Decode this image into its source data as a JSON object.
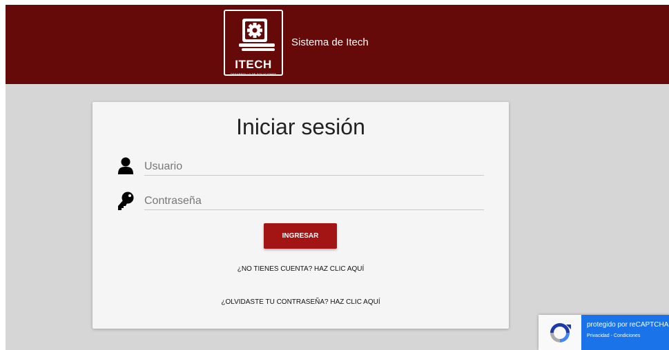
{
  "header": {
    "logo_text": "ITECH",
    "logo_subtext": "DESARROLLO DE SOLUCIONES",
    "site_title": "Sistema de Itech",
    "bg_color": "#650909"
  },
  "login": {
    "title": "Iniciar sesión",
    "username_placeholder": "Usuario",
    "password_placeholder": "Contraseña",
    "submit_label": "INGRESAR",
    "register_link": "¿NO TIENES CUENTA? HAZ CLIC AQUÍ",
    "forgot_link": "¿OLVIDASTE TU CONTRASEÑA? HAZ CLIC AQUÍ",
    "button_color": "#a31515"
  },
  "recaptcha": {
    "label": "protegido por reCAPTCHA",
    "sublabel": "Privacidad - Condiciones"
  },
  "icons": {
    "username": "user-icon",
    "password": "key-icon",
    "logo": "gear-icon"
  }
}
